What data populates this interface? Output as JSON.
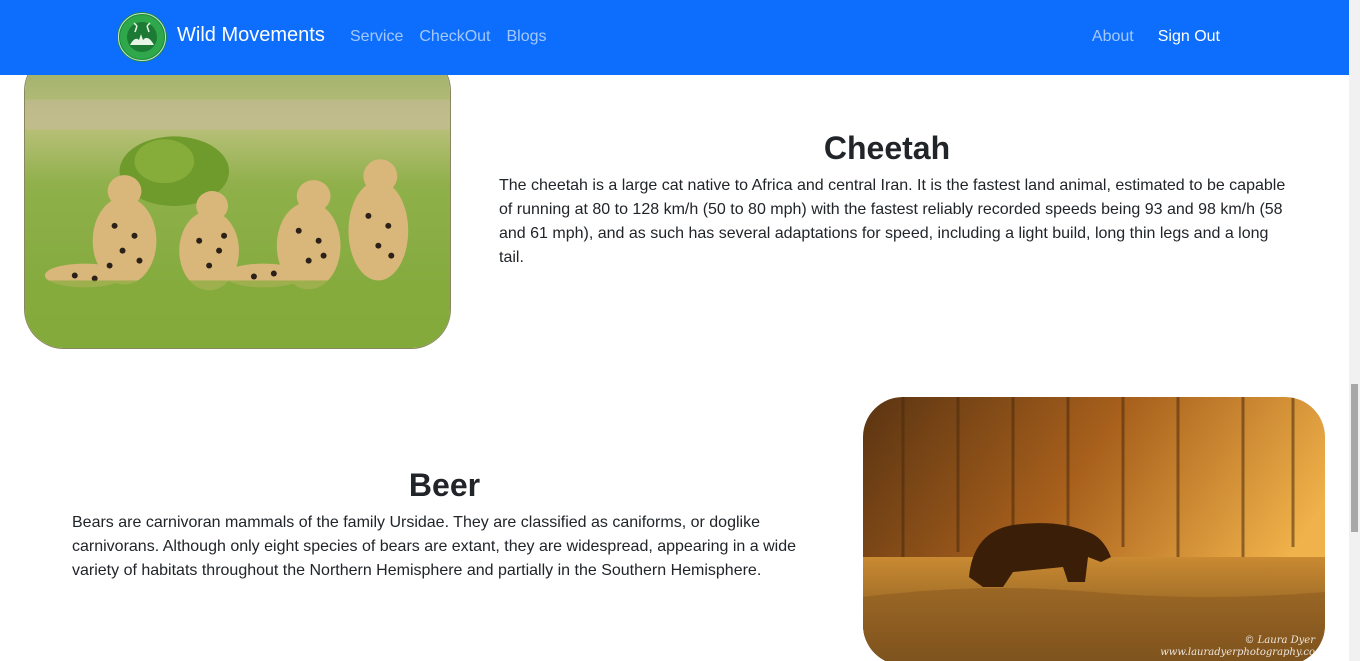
{
  "navbar": {
    "brand": "Wild Movements",
    "left_links": [
      "Service",
      "CheckOut",
      "Blogs"
    ],
    "right_links": [
      "About",
      "Sign Out"
    ],
    "bg_color": "#0d6efd"
  },
  "animals": [
    {
      "name": "Cheetah",
      "description": "The cheetah is a large cat native to Africa and central Iran. It is the fastest land animal, estimated to be capable of running at 80 to 128 km/h (50 to 80 mph) with the fastest reliably recorded speeds being 93 and 98 km/h (58 and 61 mph), and as such has several adaptations for speed, including a light build, long thin legs and a long tail."
    },
    {
      "name": "Beer",
      "description": "Bears are carnivoran mammals of the family Ursidae. They are classified as caniforms, or doglike carnivorans. Although only eight species of bears are extant, they are widespread, appearing in a wide variety of habitats throughout the Northern Hemisphere and partially in the Southern Hemisphere.",
      "photo_credit": [
        "© Laura Dyer",
        "www.lauradyerphotography.co"
      ]
    }
  ]
}
